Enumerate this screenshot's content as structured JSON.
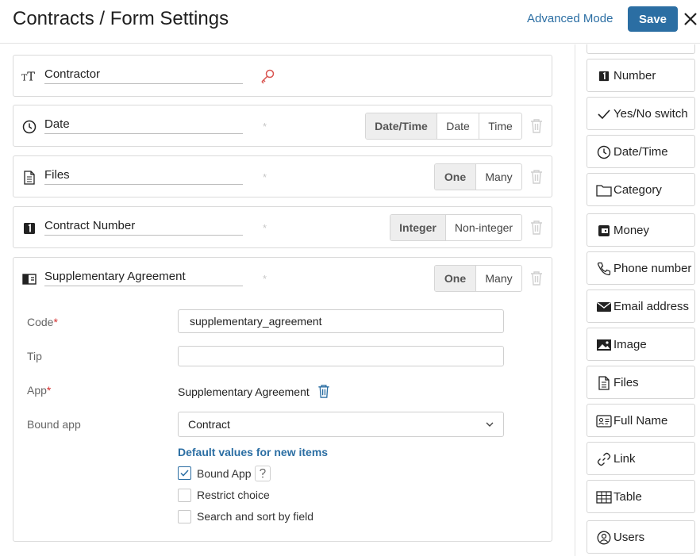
{
  "header": {
    "title": "Contracts / Form Settings",
    "advanced_mode": "Advanced Mode",
    "save": "Save"
  },
  "fields": [
    {
      "name": "Contractor"
    },
    {
      "name": "Date",
      "options": [
        "Date/Time",
        "Date",
        "Time"
      ],
      "selected": "Date/Time"
    },
    {
      "name": "Files",
      "options": [
        "One",
        "Many"
      ],
      "selected": "One"
    },
    {
      "name": "Contract Number",
      "options": [
        "Integer",
        "Non-integer"
      ],
      "selected": "Integer"
    },
    {
      "name": "Supplementary Agreement",
      "options": [
        "One",
        "Many"
      ],
      "selected": "One"
    }
  ],
  "required_mark": "*",
  "settings": {
    "code_label": "Code",
    "code_value": "supplementary_agreement",
    "tip_label": "Tip",
    "tip_value": "",
    "app_label": "App",
    "app_value": "Supplementary Agreement",
    "bound_app_label": "Bound app",
    "bound_app_value": "Contract",
    "defaults_link": "Default values for new items",
    "checkboxes": [
      {
        "label": "Bound App",
        "checked": true
      },
      {
        "label": "Restrict choice",
        "checked": false
      },
      {
        "label": "Search and sort by field",
        "checked": false
      }
    ]
  },
  "palette": [
    {
      "label": "Number",
      "icon": "number-icon"
    },
    {
      "label": "Yes/No switch",
      "icon": "check-icon"
    },
    {
      "label": "Date/Time",
      "icon": "clock-icon"
    },
    {
      "label": "Category",
      "icon": "folder-icon"
    },
    {
      "label": "Money",
      "icon": "money-icon"
    },
    {
      "label": "Phone number",
      "icon": "phone-icon"
    },
    {
      "label": "Email address",
      "icon": "envelope-icon"
    },
    {
      "label": "Image",
      "icon": "image-icon"
    },
    {
      "label": "Files",
      "icon": "file-icon"
    },
    {
      "label": "Full Name",
      "icon": "id-card-icon"
    },
    {
      "label": "Link",
      "icon": "link-icon"
    },
    {
      "label": "Table",
      "icon": "table-icon"
    },
    {
      "label": "Users",
      "icon": "user-icon"
    }
  ],
  "colors": {
    "accent": "#2b6ea3",
    "required": "#d32f2f",
    "key": "#d9534f"
  }
}
